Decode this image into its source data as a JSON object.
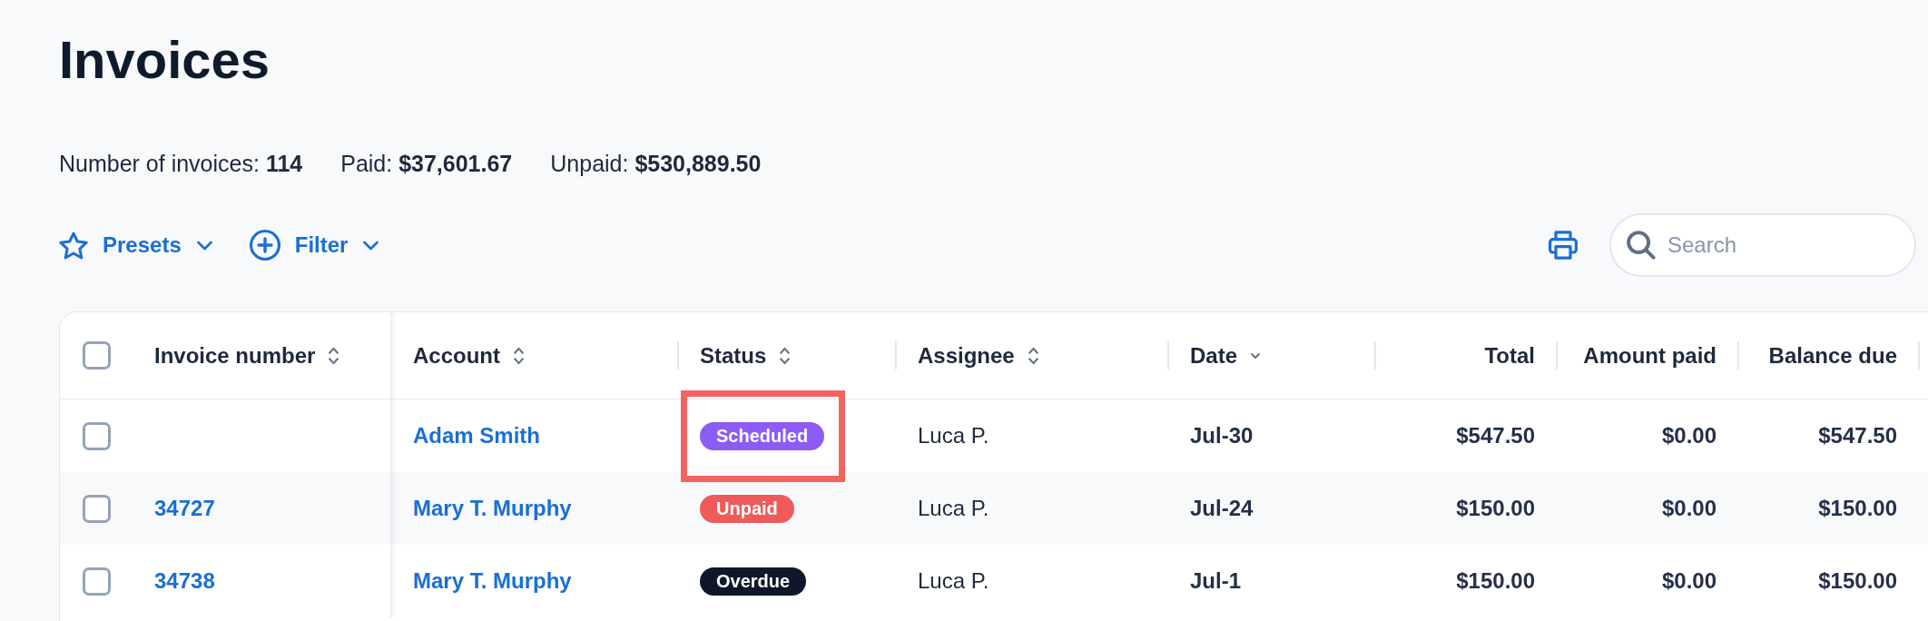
{
  "page": {
    "title": "Invoices"
  },
  "summary": [
    "Number of invoices: **114**",
    "Paid: **$37,601.67**",
    "Unpaid: **$530,889.50**"
  ],
  "toolbar": {
    "presets": {
      "label": "Presets"
    },
    "filter": {
      "label": "Filter"
    },
    "search": {
      "placeholder": "Search"
    }
  },
  "table": {
    "select_all": {
      "checked": false
    },
    "columns": [
      {
        "label": "Invoice number",
        "sortable": true,
        "sorted": false
      },
      {
        "label": "Account",
        "sortable": true,
        "sorted": false
      },
      {
        "label": "Status",
        "sortable": true,
        "sorted": false
      },
      {
        "label": "Assignee",
        "sortable": true,
        "sorted": false
      },
      {
        "label": "Date",
        "sortable": true,
        "sorted": true
      },
      {
        "label": "Total",
        "sortable": false,
        "sorted": false
      },
      {
        "label": "Amount paid",
        "sortable": false,
        "sorted": false
      },
      {
        "label": "Balance due",
        "sortable": false,
        "sorted": false
      }
    ],
    "rows": [
      {
        "checked": false,
        "account": "Adam Smith",
        "status": {
          "label": "Scheduled",
          "color": "#8b5cf6",
          "highlighted": true
        },
        "assignee": "Luca P.",
        "date": "Jul-30",
        "total": "$547.50",
        "amount_paid": "$0.00",
        "balance_due": "$547.50"
      },
      {
        "checked": false,
        "invoice_number": "34727",
        "account": "Mary T. Murphy",
        "status": {
          "label": "Unpaid",
          "color": "#ef5a5a",
          "highlighted": false
        },
        "assignee": "Luca P.",
        "date": "Jul-24",
        "total": "$150.00",
        "amount_paid": "$0.00",
        "balance_due": "$150.00"
      },
      {
        "checked": false,
        "invoice_number": "34738",
        "account": "Mary T. Murphy",
        "status": {
          "label": "Overdue",
          "color": "#0f172a",
          "highlighted": false
        },
        "assignee": "Luca P.",
        "date": "Jul-1",
        "total": "$150.00",
        "amount_paid": "$0.00",
        "balance_due": "$150.00"
      }
    ]
  }
}
